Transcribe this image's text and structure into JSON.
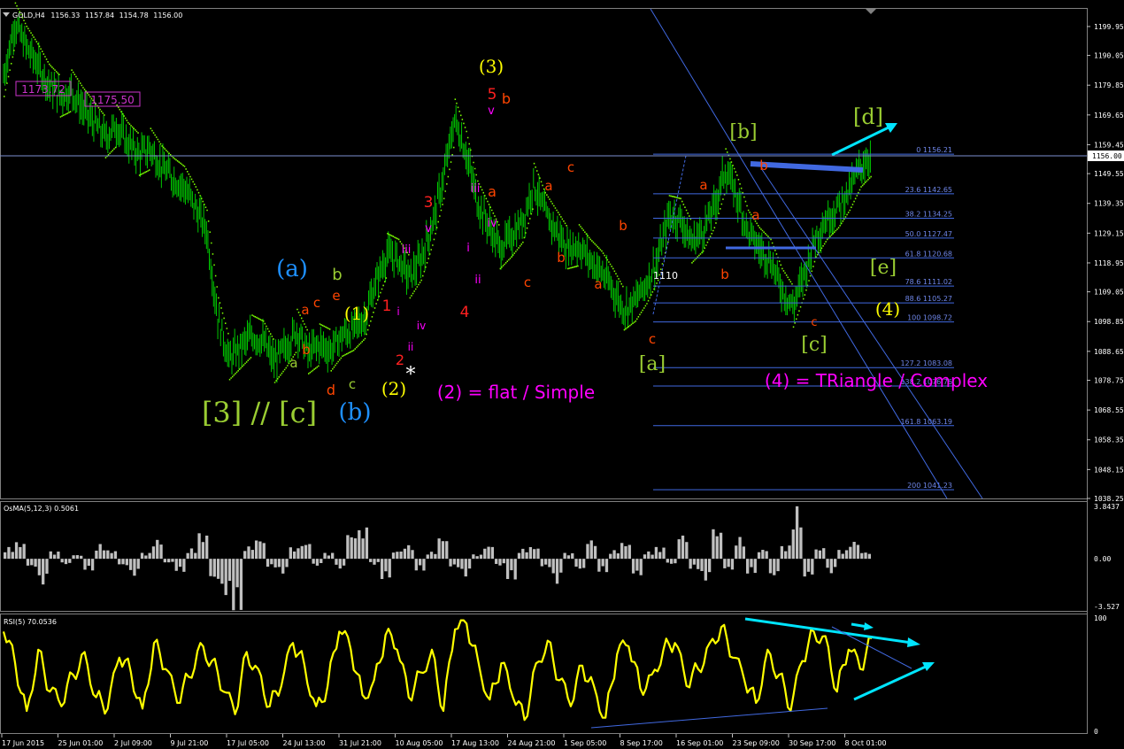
{
  "chart_data": [
    {
      "type": "line",
      "panel": "main",
      "title": "GOLD,H4",
      "ohlc_header": [
        "1156.33",
        "1157.84",
        "1154.78",
        "1156.00"
      ],
      "ylim": [
        1038.25,
        1206
      ],
      "current_price": 1156.0,
      "price_axis_labels": [
        "1199.95",
        "1190.05",
        "1179.85",
        "1169.65",
        "1159.45",
        "1149.55",
        "1139.35",
        "1129.15",
        "1118.95",
        "1109.05",
        "1098.85",
        "1088.65",
        "1078.75",
        "1068.55",
        "1058.35",
        "1048.15",
        "1038.25"
      ],
      "time_axis_labels": [
        "17 Jun 2015",
        "25 Jun 01:00",
        "2 Jul 09:00",
        "9 Jul 21:00",
        "17 Jul 05:00",
        "24 Jul 13:00",
        "31 Jul 21:00",
        "10 Aug 05:00",
        "17 Aug 13:00",
        "24 Aug 21:00",
        "1 Sep 05:00",
        "8 Sep 17:00",
        "16 Sep 01:00",
        "23 Sep 09:00",
        "30 Sep 17:00",
        "8 Oct 01:00"
      ],
      "series": [
        {
          "name": "GOLD,H4 close",
          "color": "#00ff00",
          "values": [
            1183,
            1201,
            1193,
            1187,
            1180,
            1176,
            1178,
            1172,
            1167,
            1162,
            1166,
            1160,
            1156,
            1158,
            1152,
            1148,
            1145,
            1138,
            1130,
            1100,
            1086,
            1090,
            1094,
            1092,
            1085,
            1090,
            1096,
            1088,
            1091,
            1089,
            1094,
            1096,
            1100,
            1112,
            1122,
            1120,
            1114,
            1120,
            1132,
            1148,
            1168,
            1157,
            1140,
            1132,
            1124,
            1128,
            1133,
            1146,
            1136,
            1130,
            1124,
            1125,
            1120,
            1116,
            1110,
            1103,
            1106,
            1112,
            1120,
            1135,
            1134,
            1126,
            1130,
            1138,
            1151,
            1142,
            1130,
            1124,
            1120,
            1110,
            1104,
            1115,
            1128,
            1134,
            1138,
            1144,
            1152,
            1156
          ]
        }
      ],
      "fibonacci_levels": [
        {
          "label": "0 1156.21",
          "value": 1156.21
        },
        {
          "label": "23.6 1142.65",
          "value": 1142.65
        },
        {
          "label": "38.2 1134.25",
          "value": 1134.25
        },
        {
          "label": "50.0 1127.47",
          "value": 1127.47
        },
        {
          "label": "61.8 1120.68",
          "value": 1120.68
        },
        {
          "label": "78.6 1111.02",
          "value": 1111.02
        },
        {
          "label": "88.6 1105.27",
          "value": 1105.27
        },
        {
          "label": "100 1098.72",
          "value": 1098.72
        },
        {
          "label": "127.2 1083.08",
          "value": 1083.08
        },
        {
          "label": "138.2 1076.76",
          "value": 1076.76
        },
        {
          "label": "161.8 1063.19",
          "value": 1063.19
        },
        {
          "label": "200 1041.23",
          "value": 1041.23
        }
      ],
      "price_boxes": [
        "1173.72",
        "1175.50"
      ],
      "annotations": [
        {
          "text": "(3)",
          "color": "#ffff00"
        },
        {
          "text": "5",
          "color": "#ff2020"
        },
        {
          "text": "b",
          "color": "#ff4500"
        },
        {
          "text": "v",
          "color": "#ff00ff"
        },
        {
          "text": "iii",
          "color": "#ff00ff"
        },
        {
          "text": "a",
          "color": "#ff4500"
        },
        {
          "text": "iv",
          "color": "#ff00ff"
        },
        {
          "text": "3",
          "color": "#ff2020"
        },
        {
          "text": "v",
          "color": "#ff00ff"
        },
        {
          "text": "iii",
          "color": "#ff00ff"
        },
        {
          "text": "i",
          "color": "#ff00ff"
        },
        {
          "text": "ii",
          "color": "#ff00ff"
        },
        {
          "text": "4",
          "color": "#ff2020"
        },
        {
          "text": "c",
          "color": "#ff4500"
        },
        {
          "text": "a",
          "color": "#ff4500"
        },
        {
          "text": "b",
          "color": "#ff4500"
        },
        {
          "text": "c",
          "color": "#ff4500"
        },
        {
          "text": "a",
          "color": "#ff4500"
        },
        {
          "text": "b",
          "color": "#ff4500"
        },
        {
          "text": "(a)",
          "color": "#1e90ff"
        },
        {
          "text": "b",
          "color": "#9acd32"
        },
        {
          "text": "e",
          "color": "#ff4500"
        },
        {
          "text": "c",
          "color": "#ff4500"
        },
        {
          "text": "a",
          "color": "#ff4500"
        },
        {
          "text": "b",
          "color": "#ff4500"
        },
        {
          "text": "a",
          "color": "#9acd32"
        },
        {
          "text": "d",
          "color": "#ff4500"
        },
        {
          "text": "c",
          "color": "#9acd32"
        },
        {
          "text": "(1)",
          "color": "#ffff00"
        },
        {
          "text": "1",
          "color": "#ff2020"
        },
        {
          "text": "i",
          "color": "#ff00ff"
        },
        {
          "text": "iv",
          "color": "#ff00ff"
        },
        {
          "text": "ii",
          "color": "#ff00ff"
        },
        {
          "text": "2",
          "color": "#ff2020"
        },
        {
          "text": "(2)",
          "color": "#ffff00"
        },
        {
          "text": "*",
          "color": "#ffffff"
        },
        {
          "text": "(2) = flat / Simple",
          "color": "#ff00ff"
        },
        {
          "text": "[3] // [c]",
          "color": "#9acd32"
        },
        {
          "text": "(b)",
          "color": "#1e90ff"
        },
        {
          "text": "1110",
          "color": "#ffffff"
        },
        {
          "text": "c",
          "color": "#ff4500"
        },
        {
          "text": "[a]",
          "color": "#9acd32"
        },
        {
          "text": "a",
          "color": "#ff4500"
        },
        {
          "text": "b",
          "color": "#ff4500"
        },
        {
          "text": "[b]",
          "color": "#9acd32"
        },
        {
          "text": "b",
          "color": "#ff4500"
        },
        {
          "text": "a",
          "color": "#ff4500"
        },
        {
          "text": "c",
          "color": "#ff4500"
        },
        {
          "text": "[c]",
          "color": "#9acd32"
        },
        {
          "text": "[d]",
          "color": "#9acd32"
        },
        {
          "text": "[e]",
          "color": "#9acd32"
        },
        {
          "text": "(4)",
          "color": "#ffff00"
        },
        {
          "text": "(4) = TRiangle / Complex",
          "color": "#ff00ff"
        }
      ]
    },
    {
      "type": "bar",
      "panel": "osma",
      "title": "OsMA(5,12,3) 0.5061",
      "ylim": [
        -3.527,
        3.8437
      ],
      "axis_labels": [
        "3.8437",
        "0.00",
        "-3.527"
      ],
      "series": [
        {
          "name": "OsMA(5,12,3)",
          "color": "#c0c0c0",
          "values": [
            0.8,
            1.2,
            -0.6,
            -1.8,
            0.5,
            -0.4,
            0.3,
            -0.8,
            1.0,
            0.6,
            -0.5,
            -1.2,
            0.4,
            1.4,
            -0.3,
            -0.9,
            0.7,
            1.8,
            -1.6,
            -2.6,
            -3.5,
            0.9,
            1.5,
            -0.6,
            -1.0,
            0.8,
            1.2,
            -0.5,
            0.4,
            -0.7,
            1.9,
            2.2,
            -0.4,
            -1.4,
            0.6,
            1.0,
            -0.8,
            0.5,
            1.6,
            -0.6,
            -1.2,
            0.3,
            1.0,
            -0.5,
            -1.4,
            0.7,
            0.9,
            -0.6,
            -1.7,
            0.4,
            -0.8,
            1.4,
            -0.9,
            0.6,
            1.2,
            -1.2,
            0.5,
            0.8,
            -0.4,
            1.8,
            -0.7,
            -1.5,
            2.2,
            -0.8,
            1.5,
            -1.0,
            0.7,
            -1.3,
            0.9,
            3.6,
            -1.3,
            0.8,
            -1.0,
            0.6,
            1.3,
            0.5
          ]
        }
      ]
    },
    {
      "type": "line",
      "panel": "rsi",
      "title": "RSI(5) 70.0536",
      "ylim": [
        0,
        100
      ],
      "axis_labels": [
        "100",
        "0"
      ],
      "series": [
        {
          "name": "RSI(5)",
          "color": "#ffff00",
          "values": [
            88,
            60,
            18,
            72,
            35,
            22,
            50,
            70,
            30,
            20,
            65,
            52,
            20,
            78,
            55,
            25,
            48,
            78,
            62,
            35,
            15,
            70,
            55,
            22,
            40,
            78,
            58,
            22,
            40,
            88,
            72,
            32,
            45,
            85,
            72,
            30,
            52,
            72,
            18,
            90,
            95,
            62,
            28,
            60,
            30,
            10,
            60,
            80,
            45,
            22,
            58,
            40,
            12,
            68,
            75,
            38,
            50,
            72,
            78,
            40,
            55,
            78,
            92,
            65,
            45,
            25,
            72,
            50,
            18,
            62,
            88,
            84,
            35,
            72,
            55,
            82
          ]
        }
      ]
    }
  ]
}
